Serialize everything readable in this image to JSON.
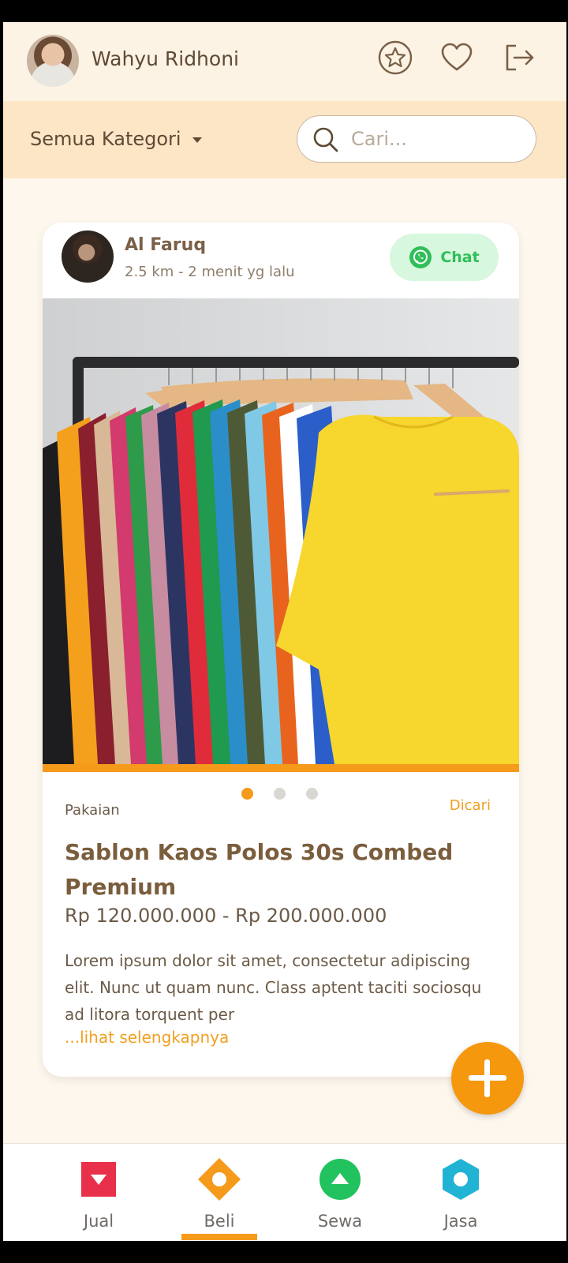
{
  "header": {
    "user_name": "Wahyu Ridhoni",
    "icons": [
      "star-icon",
      "heart-icon",
      "logout-icon"
    ]
  },
  "filter": {
    "category_label": "Semua Kategori",
    "search_placeholder": "Cari..."
  },
  "listing": {
    "seller_name": "Al Faruq",
    "seller_distance": "2.5 km",
    "seller_time": "- 2 menit yg lalu",
    "chat_label": "Chat",
    "image_count": 3,
    "active_image_index": 1,
    "category": "Pakaian",
    "status": "Dicari",
    "title": "Sablon Kaos Polos 30s Combed Premium",
    "price": "Rp 120.000.000 - Rp 200.000.000",
    "description": "Lorem ipsum dolor sit amet, consectetur adipiscing elit. Nunc ut quam nunc. Class aptent taciti sociosqu ad litora torquent per",
    "more_link": "...lihat selengkapnya"
  },
  "bottom_nav": {
    "items": [
      {
        "label": "Jual",
        "color": "#e8304a",
        "icon": "square-down-icon"
      },
      {
        "label": "Beli",
        "color": "#f59a1a",
        "icon": "diamond-icon",
        "active": true
      },
      {
        "label": "Sewa",
        "color": "#22c25e",
        "icon": "circle-up-icon"
      },
      {
        "label": "Jasa",
        "color": "#21b3d3",
        "icon": "hexagon-icon"
      }
    ]
  },
  "colors": {
    "accent": "#f59a1a",
    "header_bg": "#fdf3e4",
    "filter_bg": "#fde6c6",
    "text_brown": "#7a5d3c"
  }
}
